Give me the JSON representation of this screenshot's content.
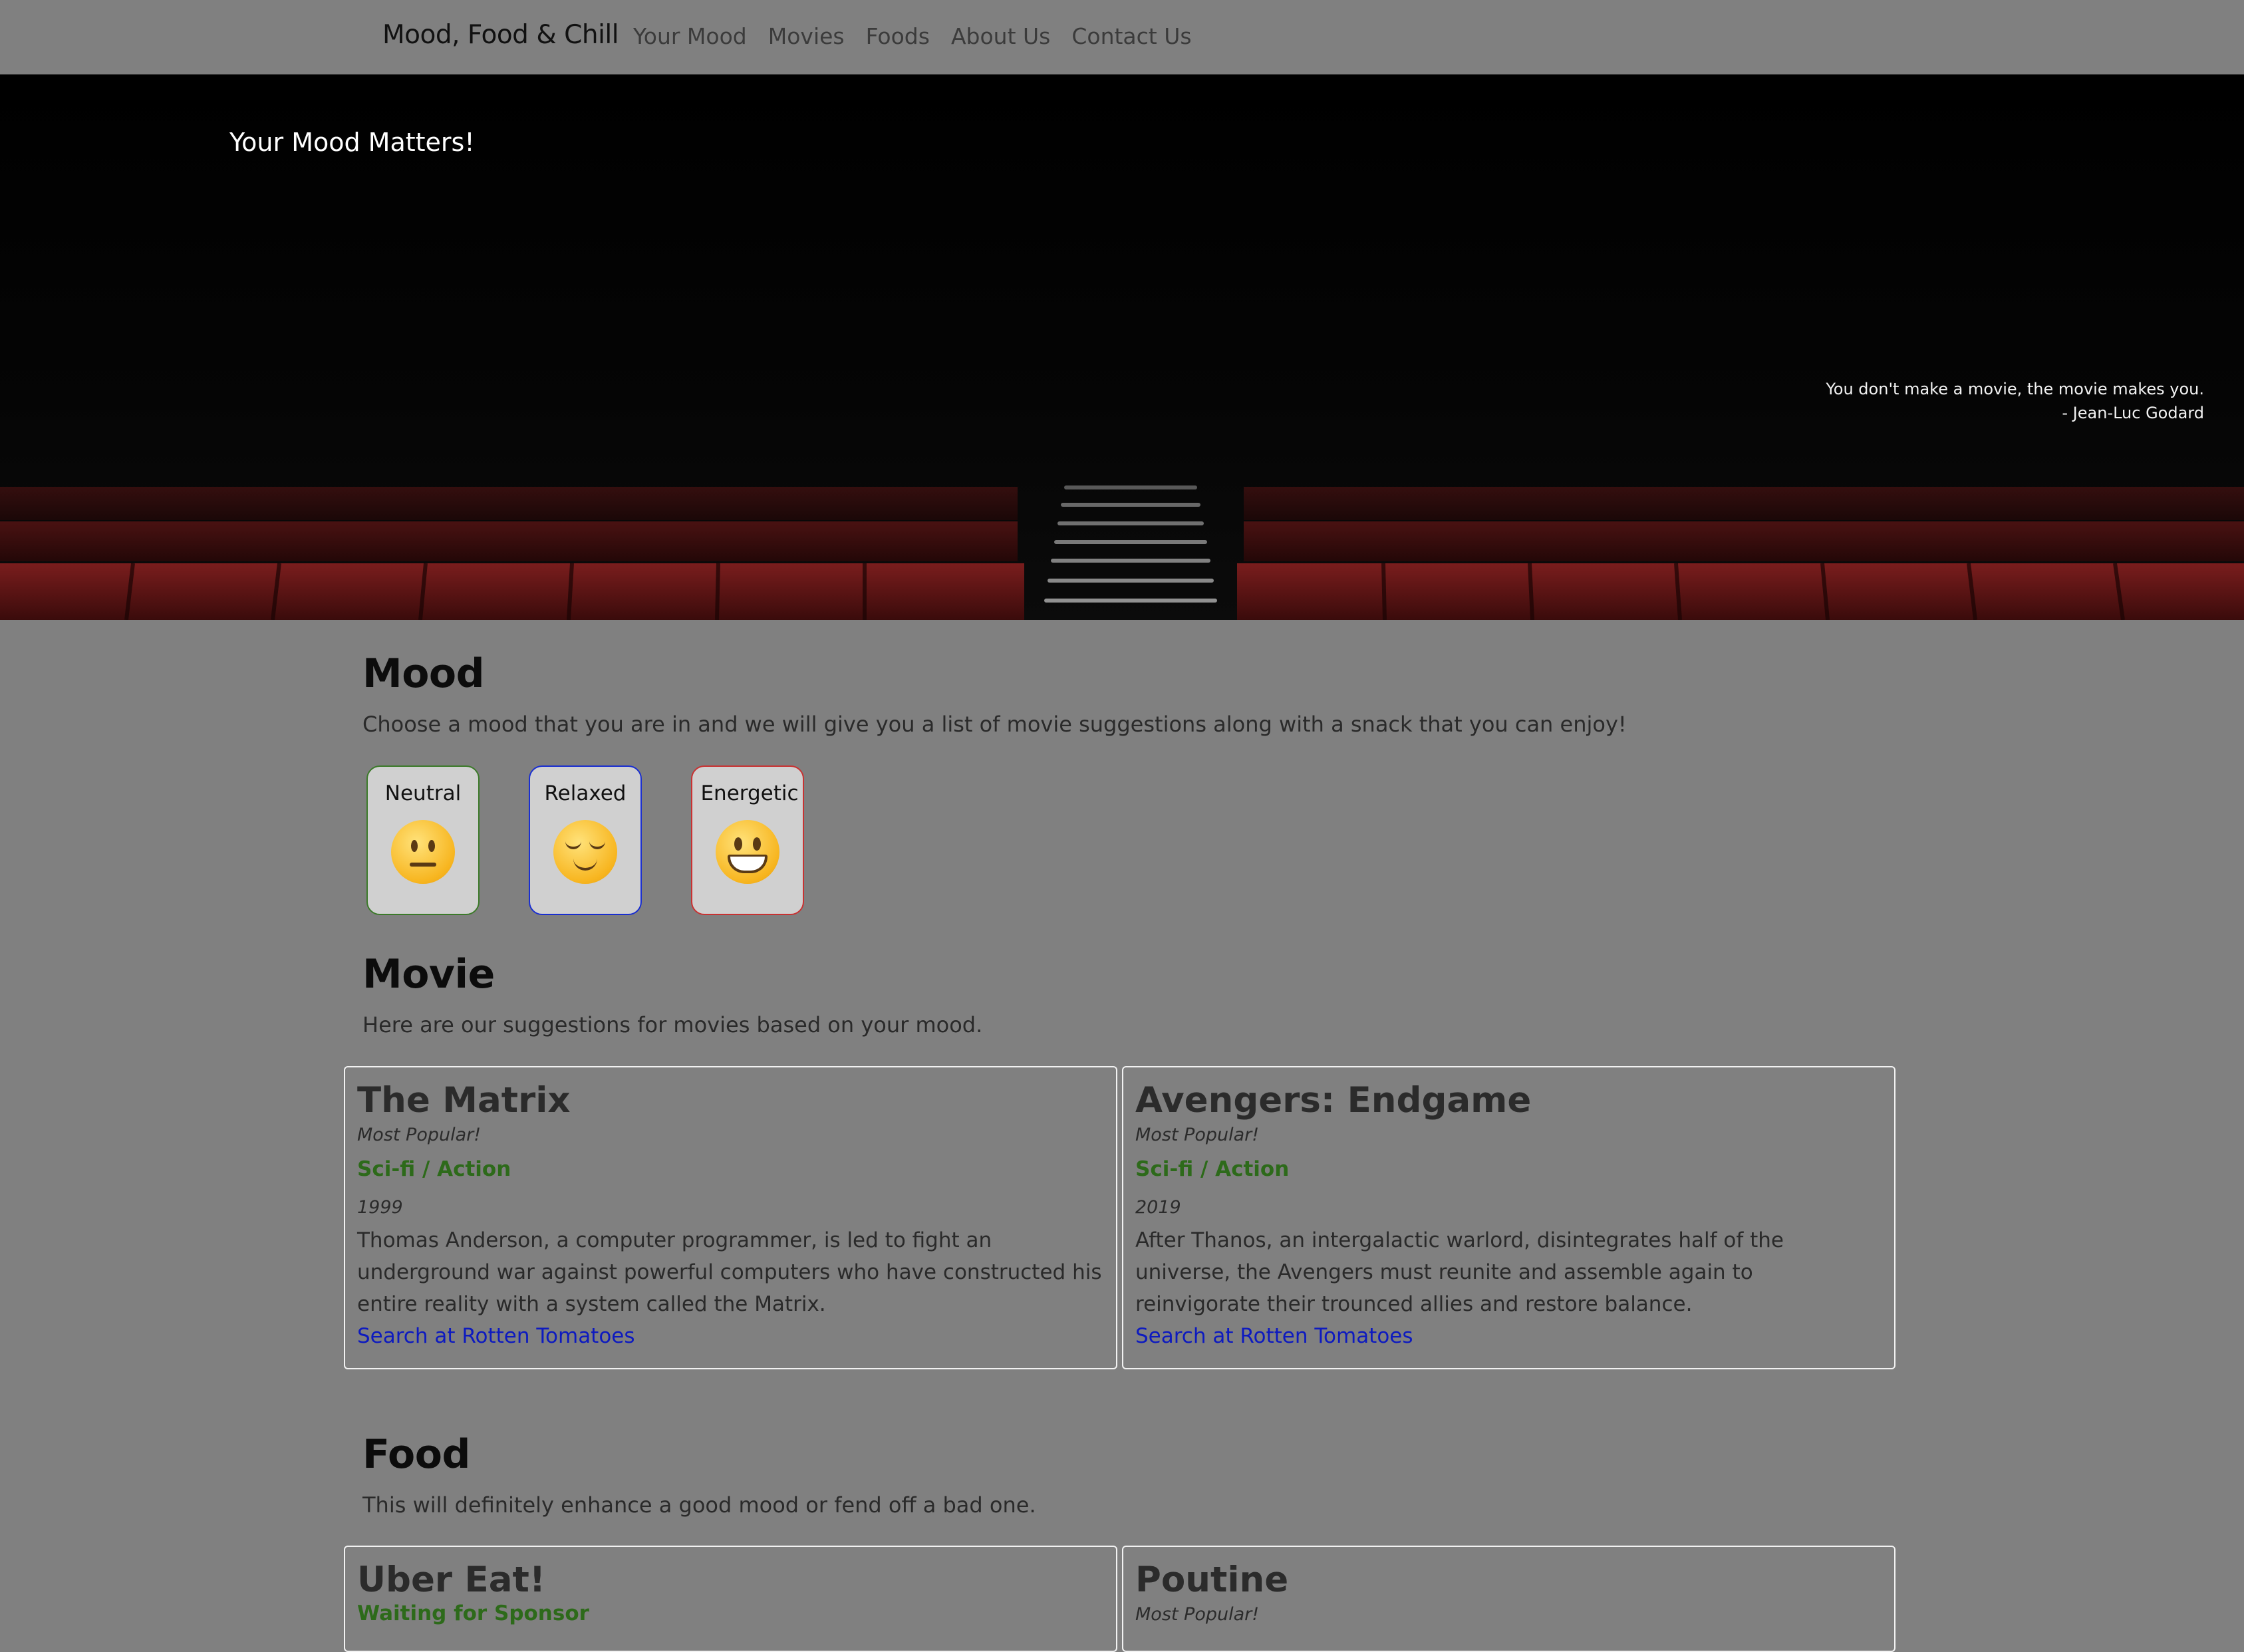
{
  "navbar": {
    "brand": "Mood, Food & Chill",
    "links": [
      "Your Mood",
      "Movies",
      "Foods",
      "About Us",
      "Contact Us"
    ]
  },
  "hero": {
    "title": "Your Mood Matters!",
    "quote_line1": "You don't make a movie, the movie makes you.",
    "quote_line2": "- Jean-Luc Godard"
  },
  "mood": {
    "title": "Mood",
    "description": "Choose a mood that you are in and we will give you a list of movie suggestions along with a snack that you can enjoy!",
    "options": [
      {
        "label": "Neutral",
        "icon": "neutral-face-icon",
        "border": "#3c7a2a"
      },
      {
        "label": "Relaxed",
        "icon": "relieved-face-icon",
        "border": "#1a2fd0"
      },
      {
        "label": "Energetic",
        "icon": "grinning-face-icon",
        "border": "#c83232"
      }
    ]
  },
  "movie": {
    "title": "Movie",
    "description": "Here are our suggestions for movies based on your mood.",
    "cards": [
      {
        "title": "The Matrix",
        "subtitle": "Most Popular!",
        "genre": "Sci-fi / Action",
        "year": "1999",
        "text": "Thomas Anderson, a computer programmer, is led to fight an underground war against powerful computers who have constructed his entire reality with a system called the Matrix.",
        "link": "Search at Rotten Tomatoes"
      },
      {
        "title": "Avengers: Endgame",
        "subtitle": "Most Popular!",
        "genre": "Sci-fi / Action",
        "year": "2019",
        "text": "After Thanos, an intergalactic warlord, disintegrates half of the universe, the Avengers must reunite and assemble again to reinvigorate their trounced allies and restore balance.",
        "link": "Search at Rotten Tomatoes"
      }
    ]
  },
  "food": {
    "title": "Food",
    "description": "This will definitely enhance a good mood or fend off a bad one.",
    "cards": [
      {
        "title": "Uber Eat!",
        "subtitle": "Waiting for Sponsor"
      },
      {
        "title": "Poutine",
        "subtitle": "Most Popular!"
      }
    ]
  },
  "colors": {
    "page_bg": "#808080",
    "hero_bg": "#020202",
    "genre_green": "#2d6a1a",
    "link_blue": "#0d1abf",
    "seat_red": "#7a1a1a"
  }
}
